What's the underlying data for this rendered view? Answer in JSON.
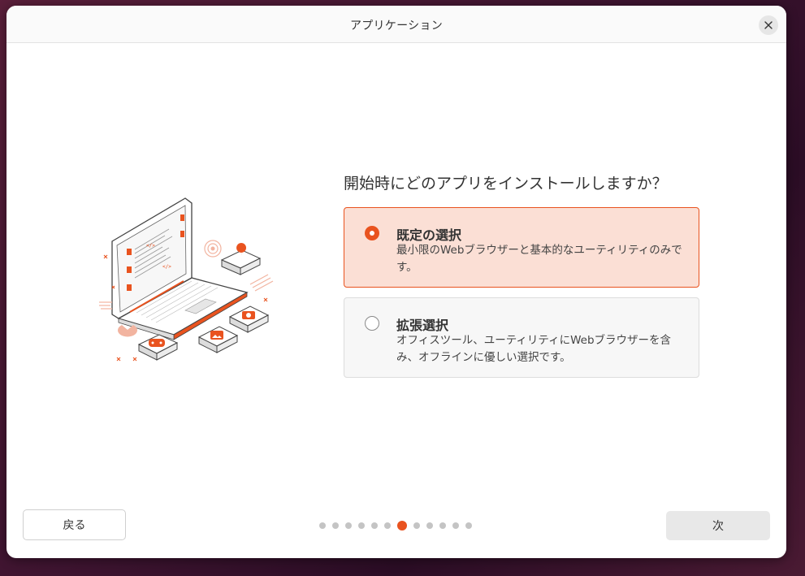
{
  "window": {
    "title": "アプリケーション",
    "close_icon": "close-icon"
  },
  "main": {
    "question": "開始時にどのアプリをインストールしますか？",
    "options": [
      {
        "title": "既定の選択",
        "description": "最小限のWebブラウザーと基本的なユーティリティのみです。",
        "selected": true
      },
      {
        "title": "拡張選択",
        "description": "オフィスツール、ユーティリティにWebブラウザーを含み、オフラインに優しい選択です。",
        "selected": false
      }
    ]
  },
  "footer": {
    "back_label": "戻る",
    "next_label": "次",
    "pagination": {
      "total": 12,
      "current": 7
    }
  },
  "colors": {
    "accent": "#e9531f",
    "selected_bg": "#fbdfd5",
    "dot_inactive": "#c4c4c4"
  }
}
